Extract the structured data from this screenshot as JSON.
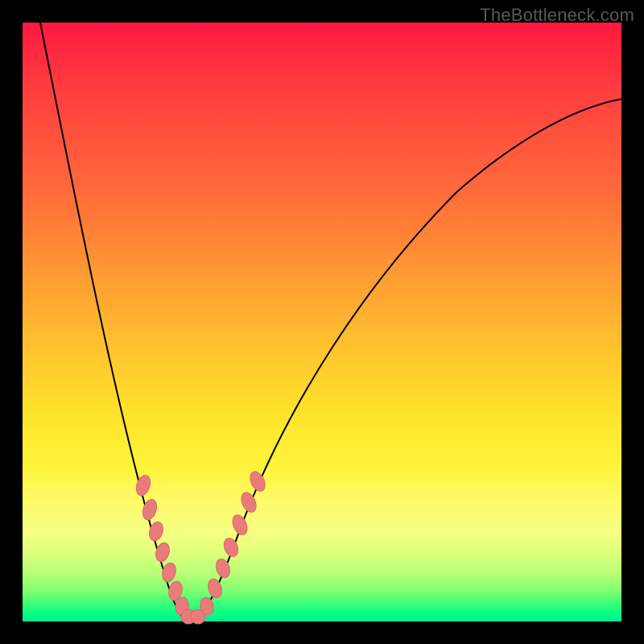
{
  "watermark": "TheBottleneck.com",
  "colors": {
    "gradient_top": "#ff173f",
    "gradient_mid": "#ffe22b",
    "gradient_bottom": "#00ff86",
    "curve": "#000000",
    "marker_fill": "#e97b7b",
    "marker_stroke": "#d96a6a",
    "frame": "#000000"
  },
  "chart_data": {
    "type": "line",
    "title": "",
    "xlabel": "",
    "ylabel": "",
    "xlim": [
      0,
      100
    ],
    "ylim": [
      0,
      100
    ],
    "grid": false,
    "legend": false,
    "series": [
      {
        "name": "bottleneck-curve",
        "x": [
          3,
          5,
          7,
          9,
          11,
          13,
          15,
          17,
          19,
          21,
          22,
          23,
          24,
          25,
          26,
          27,
          29,
          31,
          33,
          36,
          40,
          45,
          50,
          56,
          63,
          71,
          80,
          90,
          100
        ],
        "values": [
          100,
          90,
          80,
          70,
          61,
          53,
          45,
          38,
          31,
          24,
          20,
          16,
          12,
          8,
          4,
          0,
          0,
          6,
          15,
          24,
          34,
          44,
          52,
          60,
          67,
          73,
          78,
          82,
          85
        ]
      }
    ],
    "markers": {
      "description": "highlighted points near curve minimum",
      "x": [
        19,
        20,
        21,
        22,
        23,
        24,
        25,
        26,
        27,
        28,
        29,
        30,
        31,
        32,
        33
      ],
      "y": [
        31,
        27,
        24,
        20,
        16,
        12,
        8,
        4,
        0,
        0,
        0,
        3,
        6,
        11,
        15
      ]
    }
  }
}
